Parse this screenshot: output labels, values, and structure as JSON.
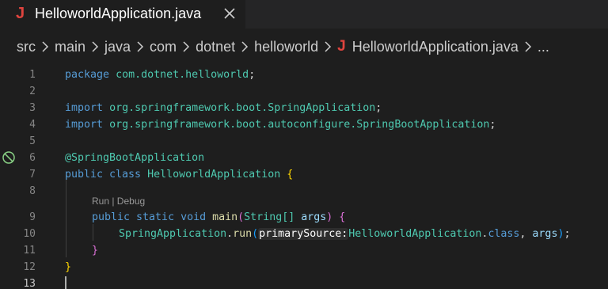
{
  "tab": {
    "icon": "J",
    "title": "HelloworldApplication.java",
    "close_icon": "close-icon"
  },
  "breadcrumb": {
    "items": [
      "src",
      "main",
      "java",
      "com",
      "dotnet",
      "helloworld"
    ],
    "file_icon": "J",
    "file": "HelloworldApplication.java",
    "more": "..."
  },
  "editor": {
    "line_numbers": [
      "1",
      "2",
      "3",
      "4",
      "5",
      "6",
      "7",
      "8",
      "9",
      "10",
      "11",
      "12",
      "13"
    ],
    "codelens": "Run | Debug",
    "inlay_hint": "primarySource:",
    "gutter_icon": "no-entry-icon",
    "code": {
      "l1_kw": "package",
      "l1_pkg": "com.dotnet.helloworld",
      "l3_kw": "import",
      "l3_pkg": "org.springframework.boot.",
      "l3_type": "SpringApplication",
      "l4_kw": "import",
      "l4_pkg": "org.springframework.boot.autoconfigure.",
      "l4_type": "SpringBootApplication",
      "l6_anno": "@SpringBootApplication",
      "l7_kw": "public class",
      "l7_type": "HelloworldApplication",
      "l9_kw": "public static void",
      "l9_fn": "main",
      "l9_type": "String[]",
      "l9_param": "args",
      "l10_type": "SpringApplication",
      "l10_fn": "run",
      "l10_type2": "HelloworldApplication",
      "l10_kw": "class",
      "l10_param": "args"
    }
  }
}
